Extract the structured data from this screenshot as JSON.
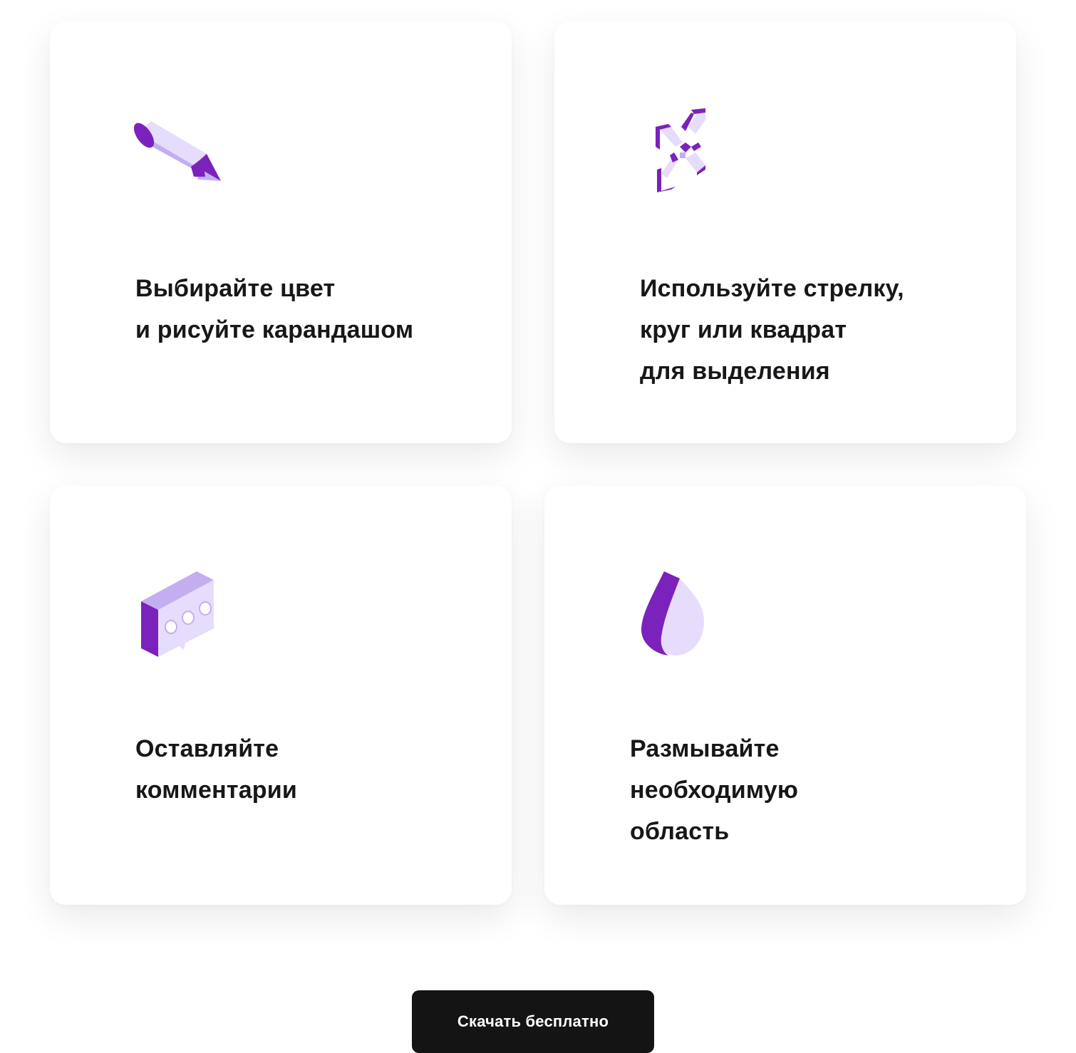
{
  "colors": {
    "accent": "#7b22bc",
    "accent_light": "#e6dcfc",
    "accent_mid": "#c3aef2",
    "button_bg": "#141414",
    "text": "#17171a"
  },
  "features": [
    {
      "icon": "pencil-icon",
      "lines": [
        "Выбирайте цвет",
        "и рисуйте карандашом"
      ]
    },
    {
      "icon": "arrows-icon",
      "lines": [
        "Используйте стрелку,",
        "круг или квадрат",
        "для выделения"
      ]
    },
    {
      "icon": "comment-icon",
      "lines": [
        "Оставляйте",
        "комментарии"
      ]
    },
    {
      "icon": "blur-drop-icon",
      "lines": [
        "Размывайте",
        "необходимую",
        "область"
      ]
    }
  ],
  "cta": {
    "download_label": "Скачать бесплатно"
  }
}
